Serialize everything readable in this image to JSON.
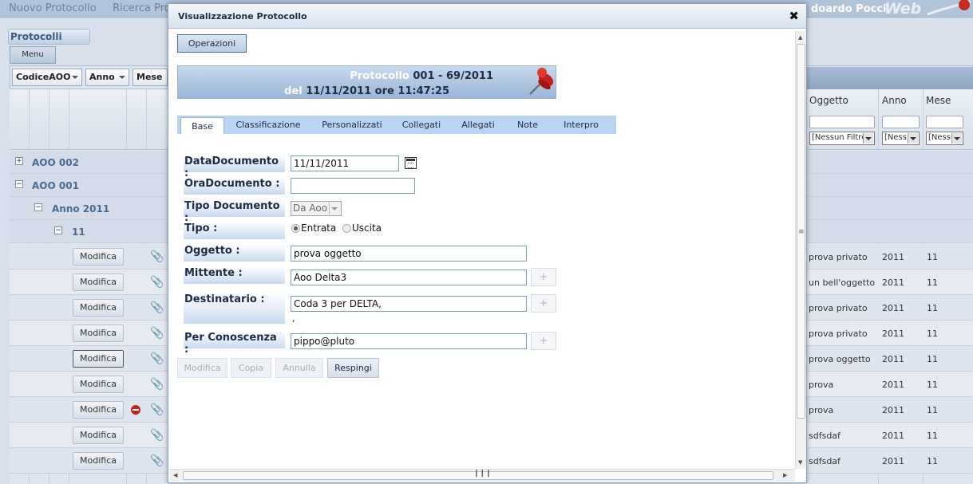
{
  "topbar": {
    "items": [
      "Nuovo Protocollo",
      "Ricerca Pro"
    ],
    "user": "doardo Pocci",
    "brand": "Web"
  },
  "sidebar": {
    "title": "Protocolli",
    "menu_label": "Menu"
  },
  "filters": {
    "codice": "CodiceAOO",
    "anno": "Anno",
    "mese": "Mese"
  },
  "columns": {
    "oggetto": "Oggetto",
    "anno": "Anno",
    "mese": "Mese"
  },
  "column_filters": {
    "oggetto": "[Nessun Filtro",
    "anno": "[Ness",
    "mese": "[Ness"
  },
  "groups": [
    {
      "label": "AOO 002",
      "toggle": "+"
    },
    {
      "label": "AOO 001",
      "toggle": "−"
    },
    {
      "label": "Anno 2011",
      "toggle": "−"
    },
    {
      "label": "11",
      "toggle": "−"
    }
  ],
  "rows": [
    {
      "action": "Modifica",
      "oggetto": "prova privato",
      "anno": "2011",
      "mese": "11"
    },
    {
      "action": "Modifica",
      "oggetto": "un bell'oggetto",
      "anno": "2011",
      "mese": "11"
    },
    {
      "action": "Modifica",
      "oggetto": "prova privato",
      "anno": "2011",
      "mese": "11"
    },
    {
      "action": "Modifica",
      "oggetto": "prova privato",
      "anno": "2011",
      "mese": "11"
    },
    {
      "action": "Modifica",
      "oggetto": "prova oggetto",
      "anno": "2011",
      "mese": "11"
    },
    {
      "action": "Modifica",
      "oggetto": "prova",
      "anno": "2011",
      "mese": "11"
    },
    {
      "action": "Modifica",
      "oggetto": "prova",
      "anno": "2011",
      "mese": "11"
    },
    {
      "action": "Modifica",
      "oggetto": "sdfsdaf",
      "anno": "2011",
      "mese": "11"
    },
    {
      "action": "Modifica",
      "oggetto": "sdfsdaf",
      "anno": "2011",
      "mese": "11"
    }
  ],
  "modal": {
    "title": "Visualizzazione Protocollo",
    "close": "✖",
    "operazioni": "Operazioni",
    "banner": {
      "protocollo_word": "Protocollo",
      "protocollo_num": "001 - 69/2011",
      "del_word": "del",
      "del_value": "11/11/2011 ore 11:47:25"
    },
    "tabs": [
      "Base",
      "Classificazione",
      "Personalizzati",
      "Collegati",
      "Allegati",
      "Note",
      "Interpro"
    ],
    "form": {
      "data_label": "DataDocumento :",
      "data_value": "11/11/2011",
      "ora_label": "OraDocumento :",
      "ora_value": "",
      "tipodoc_label": "Tipo Documento :",
      "tipodoc_value": "Da Aoo",
      "tipo_label": "Tipo :",
      "tipo_entrata": "Entrata",
      "tipo_uscita": "Uscita",
      "oggetto_label": "Oggetto :",
      "oggetto_value": "prova oggetto",
      "mittente_label": "Mittente :",
      "mittente_value": "Aoo Delta3",
      "destinatario_label": "Destinatario :",
      "destinatario_value": "Coda 3 per DELTA,",
      "destinatario_extra": ",",
      "conoscenza_label": "Per Conoscenza :",
      "conoscenza_value": "pippo@pluto",
      "plus": "+"
    },
    "actions": {
      "modifica": "Modifica",
      "copia": "Copia",
      "annulla": "Annulla",
      "respingi": "Respingi"
    }
  },
  "colors": {
    "accent": "#b9d3f3",
    "banner": "#9ab6d8",
    "title_text": "#1e2d42"
  }
}
